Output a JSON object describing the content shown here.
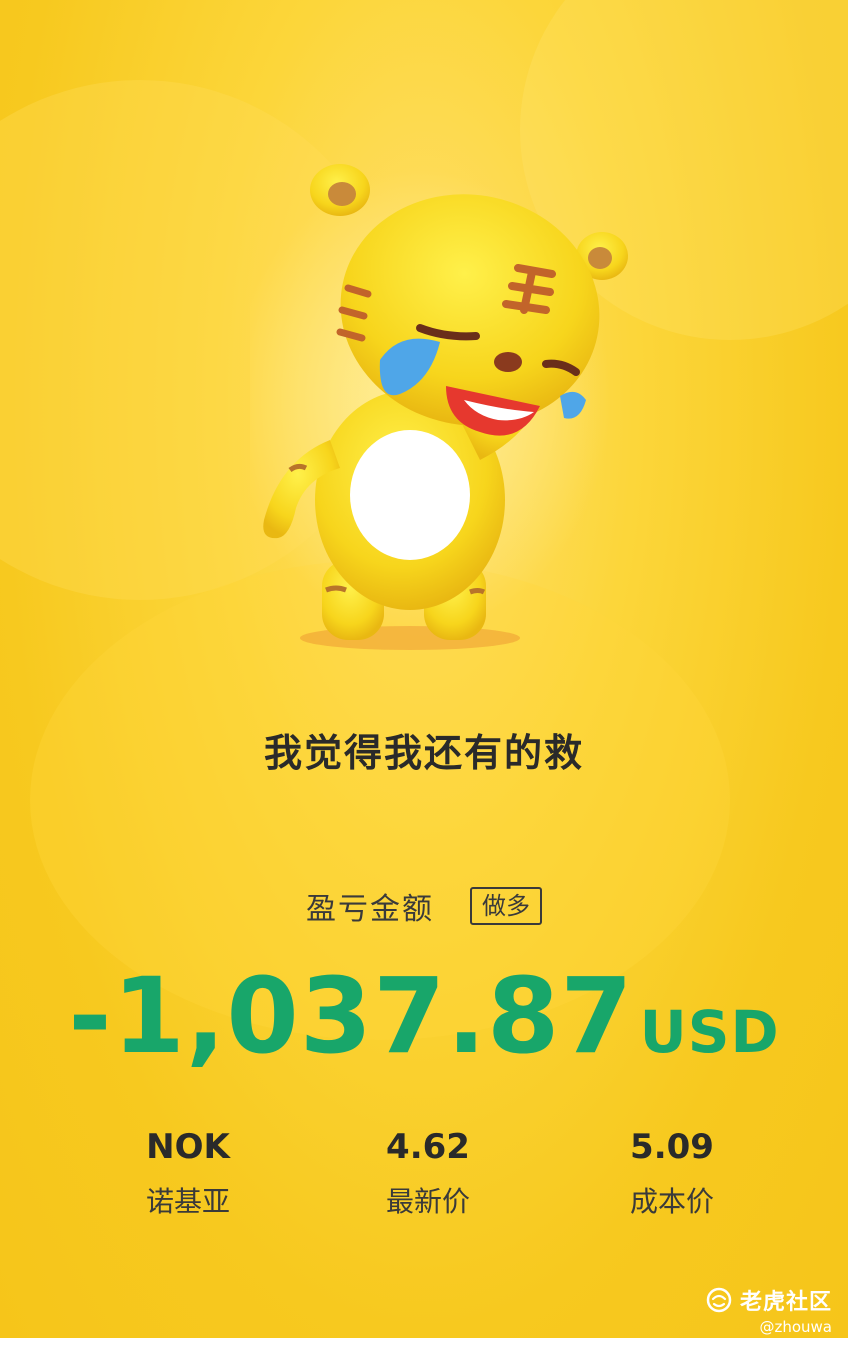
{
  "headline": "我觉得我还有的救",
  "pnl": {
    "label": "盈亏金额",
    "direction": "做多",
    "amount": "-1,037.87",
    "currency": "USD",
    "color": "#18a66a"
  },
  "stats": [
    {
      "value": "NOK",
      "label": "诺基亚"
    },
    {
      "value": "4.62",
      "label": "最新价"
    },
    {
      "value": "5.09",
      "label": "成本价"
    }
  ],
  "watermark": {
    "brand": "老虎社区",
    "user": "@zhouwa"
  },
  "mascot": {
    "icon": "crying-tiger-mascot"
  }
}
